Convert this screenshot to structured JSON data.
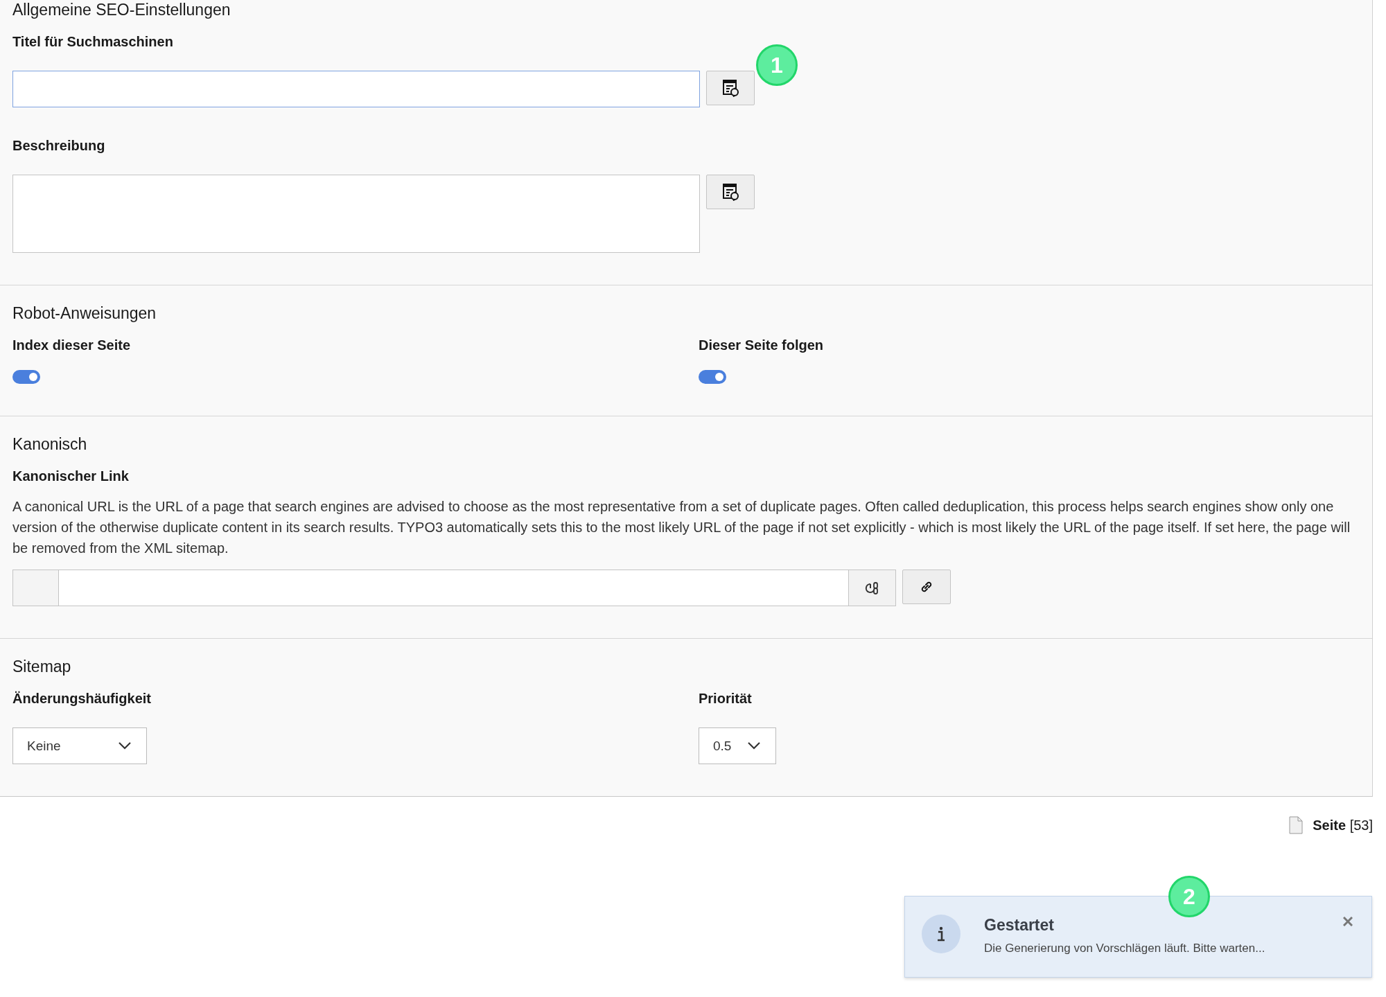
{
  "sections": [
    {
      "kind": "fields",
      "title": "Allgemeine SEO-Einstellungen",
      "fields": [
        {
          "kind": "input",
          "label": "Titel für Suchmaschinen",
          "step": "1"
        },
        {
          "kind": "textarea",
          "label": "Beschreibung"
        }
      ]
    },
    {
      "kind": "toggles",
      "title": "Robot-Anweisungen",
      "toggles": [
        {
          "label": "Index dieser Seite",
          "on": true
        },
        {
          "label": "Dieser Seite folgen",
          "on": true
        }
      ]
    },
    {
      "kind": "link",
      "title": "Kanonisch",
      "label": "Kanonischer Link",
      "description": "A canonical URL is the URL of a page that search engines are advised to choose as the most representative from a set of duplicate pages. Often called deduplication, this process helps search engines show only one version of the otherwise duplicate content in its search results. TYPO3 automatically sets this to the most likely URL of the page if not set explicitly - which is most likely the URL of the page itself. If set here, the page will be removed from the XML sitemap."
    },
    {
      "kind": "selects",
      "title": "Sitemap",
      "selects": [
        {
          "label": "Änderungshäufigkeit",
          "value": "Keine"
        },
        {
          "label": "Priorität",
          "value": "0.5"
        }
      ]
    }
  ],
  "record": {
    "type": "Seite",
    "id": "[53]"
  },
  "notification": {
    "title": "Gestartet",
    "message": "Die Generierung von Vorschlägen läuft. Bitte warten...",
    "step": "2"
  }
}
